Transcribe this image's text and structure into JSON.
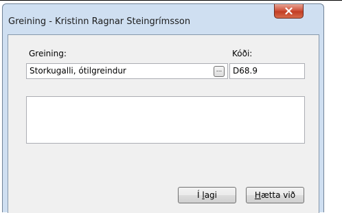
{
  "window": {
    "title": "Greining - Kristinn Ragnar Steingrímsson",
    "close_icon": "close-icon"
  },
  "form": {
    "diagnosis_label": "Greining:",
    "diagnosis_value": "Storkugalli, ótilgreindur",
    "browse_label": "...",
    "code_label": "Kóði:",
    "code_value": "D68.9",
    "notes_value": ""
  },
  "buttons": {
    "ok_prefix": "Í ",
    "ok_accel": "l",
    "ok_suffix": "agi",
    "cancel_accel": "H",
    "cancel_suffix": "ætta við"
  }
}
